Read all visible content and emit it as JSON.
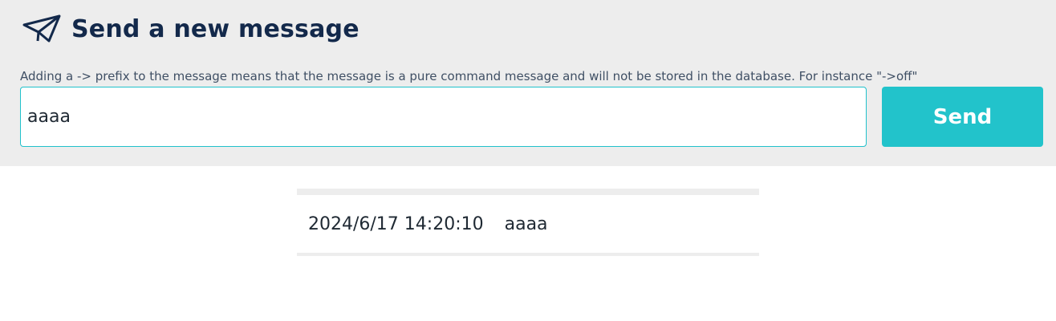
{
  "header": {
    "title": "Send a new message",
    "icon": "paper-plane-icon",
    "title_color": "#13294b"
  },
  "form": {
    "hint": "Adding a -> prefix to the message means that the message is a pure command message and will not be stored in the database. For instance \"->off\"",
    "input_value": "aaaa",
    "send_label": "Send",
    "accent_color": "#22c3cb"
  },
  "messages": [
    {
      "timestamp": "2024/6/17 14:20:10",
      "text": "aaaa"
    }
  ]
}
